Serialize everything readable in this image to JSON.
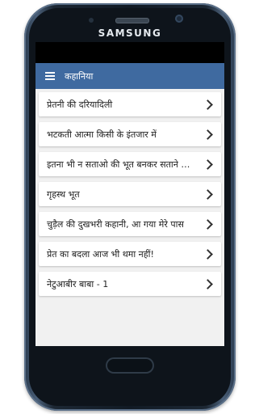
{
  "device": {
    "brand": "SAMSUNG"
  },
  "appbar": {
    "title": "कहानिया",
    "menu_icon": "hamburger-menu-icon"
  },
  "list": {
    "items": [
      {
        "label": "प्रेतनी की दरियादिली"
      },
      {
        "label": "भटकती आत्मा किसी के इंतजार में"
      },
      {
        "label": "इतना भी न सताओ की भूत बनकर सताने आ जाऊं"
      },
      {
        "label": "गृहस्थ भूत"
      },
      {
        "label": "चुड़ैल की दुखभरी कहानी, आ गया मेरे पास"
      },
      {
        "label": "प्रेत का बदला आज भी थमा नहीं!"
      },
      {
        "label": "नेटुआबीर बाबा - 1"
      }
    ]
  },
  "colors": {
    "appbar": "#3f6aa0",
    "background": "#f1f1f1"
  }
}
